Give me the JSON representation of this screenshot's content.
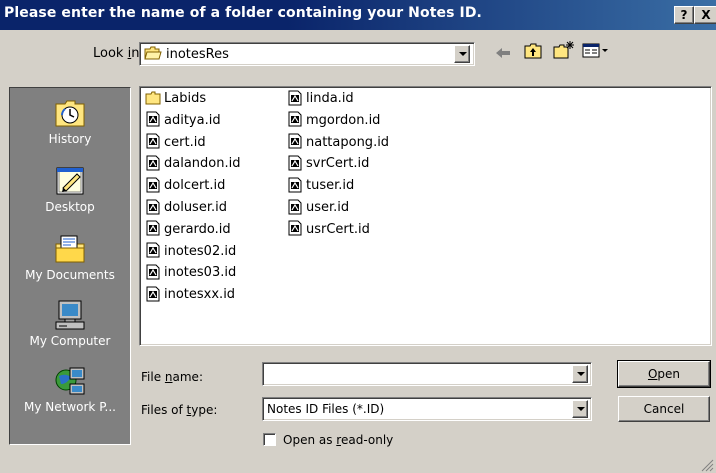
{
  "title": "Please enter the name of a folder containing your Notes ID.",
  "titlebar": {
    "help_label": "?",
    "close_label": "X"
  },
  "look_in": {
    "label_pre": "Look ",
    "label_key": "i",
    "label_post": "n:",
    "value": "inotesRes"
  },
  "places": [
    {
      "label": "History",
      "icon": "history-icon"
    },
    {
      "label": "Desktop",
      "icon": "desktop-icon"
    },
    {
      "label": "My Documents",
      "icon": "my-documents-icon"
    },
    {
      "label": "My Computer",
      "icon": "my-computer-icon"
    },
    {
      "label": "My Network P...",
      "icon": "my-network-places-icon"
    }
  ],
  "files": {
    "column1": [
      "Labids",
      "aditya.id",
      "cert.id",
      "dalandon.id",
      "dolcert.id",
      "doluser.id",
      "gerardo.id",
      "inotes02.id",
      "inotes03.id",
      "inotesxx.id"
    ],
    "column2": [
      "linda.id",
      "mgordon.id",
      "nattapong.id",
      "svrCert.id",
      "tuser.id",
      "user.id",
      "usrCert.id"
    ]
  },
  "file_name": {
    "label_pre": "File ",
    "label_key": "n",
    "label_post": "ame:",
    "value": ""
  },
  "files_of_type": {
    "label_pre": "Files of ",
    "label_key": "t",
    "label_post": "ype:",
    "value": "Notes ID Files (*.ID)"
  },
  "readonly": {
    "label_pre": "Open as ",
    "label_key": "r",
    "label_post": "ead-only",
    "checked": false
  },
  "buttons": {
    "open_key": "O",
    "open_rest": "pen",
    "cancel": "Cancel"
  },
  "colors": {
    "titlebar": "#0a246a",
    "face": "#d4d0c8",
    "places_bg": "#808080"
  }
}
